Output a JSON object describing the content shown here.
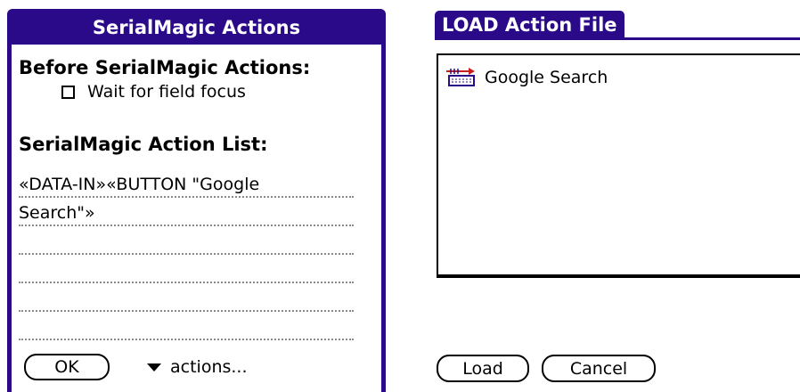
{
  "left_dialog": {
    "title": "SerialMagic Actions",
    "before_heading": "Before SerialMagic Actions:",
    "wait_checkbox": {
      "label": "Wait for field focus",
      "checked": false
    },
    "list_heading": "SerialMagic Action List:",
    "action_lines": [
      "«DATA-IN»«BUTTON \"Google",
      "Search\"»",
      "",
      "",
      "",
      ""
    ],
    "ok_label": "OK",
    "actions_label": "actions..."
  },
  "right_form": {
    "title": "LOAD Action File",
    "files": [
      {
        "name": "Google Search",
        "icon": "action-file-icon"
      }
    ],
    "load_label": "Load",
    "cancel_label": "Cancel"
  },
  "colors": {
    "title_bar": "#2b0a8a"
  }
}
